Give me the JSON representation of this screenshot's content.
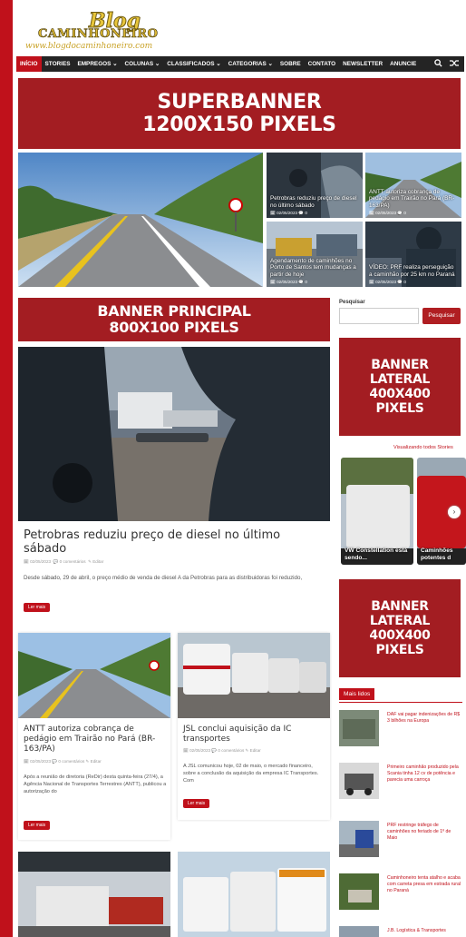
{
  "site": {
    "logo_blog": "Blog",
    "logo_cami": "CAMINHONEIRO",
    "logo_url": "www.blogdocaminhoneiro.com"
  },
  "nav": {
    "items": [
      "INÍCIO",
      "STORIES",
      "EMPREGOS ⌄",
      "COLUNAS ⌄",
      "CLASSIFICADOS ⌄",
      "CATEGORIAS ⌄",
      "SOBRE",
      "CONTATO",
      "NEWSLETTER",
      "ANUNCIE"
    ],
    "search_icon": "search-icon",
    "random_icon": "shuffle-icon"
  },
  "banners": {
    "super": [
      "SUPERBANNER",
      "1200X150 PIXELS"
    ],
    "principal": [
      "BANNER PRINCIPAL",
      "800X100 PIXELS"
    ],
    "lateral1": [
      "BANNER LATERAL",
      "400X400",
      "PIXELS"
    ],
    "lateral2": [
      "BANNER LATERAL",
      "400X400",
      "PIXELS"
    ]
  },
  "featured": [
    {
      "title": "Petrobras reduziu preço de diesel no último sábado",
      "date": "02/05/2023",
      "comments": "0"
    },
    {
      "title": "ANTT autoriza cobrança de pedágio em Trairão no Pará (BR-163/PA)",
      "date": "02/05/2023",
      "comments": "0"
    },
    {
      "title": "Agendamento de caminhões no Porto de Santos tem mudanças a partir de hoje",
      "date": "02/05/2023",
      "comments": "0"
    },
    {
      "title": "VÍDEO: PRF realiza perseguição a caminhão por 25 km no Paraná",
      "date": "02/05/2023",
      "comments": "0"
    }
  ],
  "main_post": {
    "title": "Petrobras reduziu preço de diesel no último sábado",
    "date": "02/05/2023",
    "comments": "0 comentários",
    "edit": "Editar",
    "excerpt": "Desde sábado, 29 de abril, o preço médio de venda de diesel A da Petrobras para as distribuidoras foi reduzido,",
    "button": "Ler mais"
  },
  "posts": [
    {
      "title": "ANTT autoriza cobrança de pedágio em Trairão no Pará (BR-163/PA)",
      "date": "02/05/2023",
      "comments": "0 comentários",
      "edit": "Editar",
      "excerpt": "Após a reunião de diretoria (ReDir) desta quinta-feira (27/4), a Agência Nacional de Transportes Terrestres (ANTT), publicou a autorização do",
      "button": "Ler mais"
    },
    {
      "title": "JSL conclui aquisição da IC transportes",
      "date": "02/05/2023",
      "comments": "0 comentários",
      "edit": "Editar",
      "excerpt": "A JSL comunicou hoje, 02 de maio, o mercado financeiro, sobre a conclusão da aquisição da empresa IC Transportes. Com",
      "button": "Ler mais"
    }
  ],
  "sidebar": {
    "search_label": "Pesquisar",
    "search_button": "Pesquisar",
    "stories_link": "Visualizando todos Stories",
    "stories": [
      "VW Constellation está sendo...",
      "Caminhões potentes d"
    ],
    "mais_lidos_title": "Mais lidos",
    "mais_lidos": [
      "DAF vai pagar indenizações de R$ 3 bilhões na Europa",
      "Primeiro caminhão produzido pela Scania tinha 12 cv de potência e parecia uma carroça",
      "PRF restringe tráfego de caminhões no feriado de 1º de Maio",
      "Caminhoneiro tenta atalho e acaba com carreta presa em estrada rural no Paraná",
      "J.B. Logística & Transportes"
    ]
  },
  "colors": {
    "brand": "#c0111b",
    "banner": "#a31d22",
    "nav": "#242424"
  }
}
